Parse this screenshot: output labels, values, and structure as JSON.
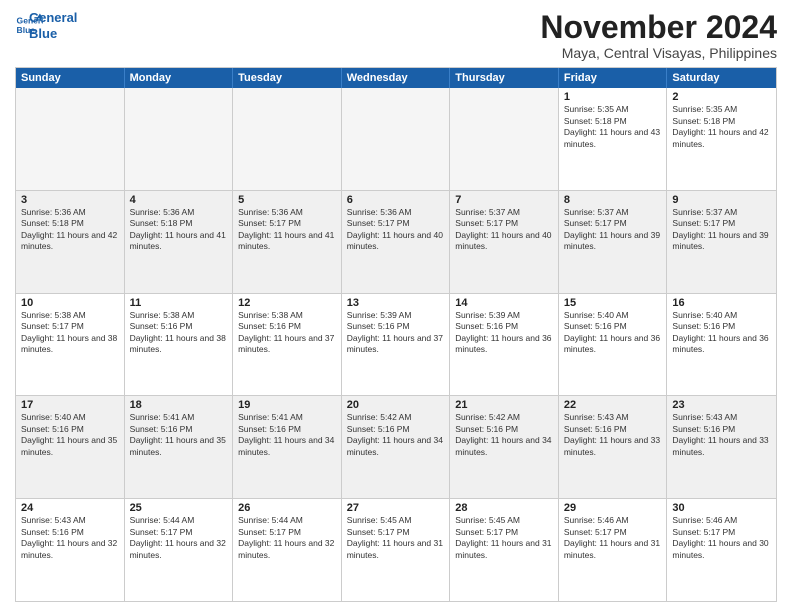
{
  "logo": {
    "line1": "General",
    "line2": "Blue"
  },
  "title": "November 2024",
  "location": "Maya, Central Visayas, Philippines",
  "days_of_week": [
    "Sunday",
    "Monday",
    "Tuesday",
    "Wednesday",
    "Thursday",
    "Friday",
    "Saturday"
  ],
  "weeks": [
    [
      {
        "day": "",
        "info": "",
        "empty": true
      },
      {
        "day": "",
        "info": "",
        "empty": true
      },
      {
        "day": "",
        "info": "",
        "empty": true
      },
      {
        "day": "",
        "info": "",
        "empty": true
      },
      {
        "day": "",
        "info": "",
        "empty": true
      },
      {
        "day": "1",
        "info": "Sunrise: 5:35 AM\nSunset: 5:18 PM\nDaylight: 11 hours and 43 minutes.",
        "empty": false
      },
      {
        "day": "2",
        "info": "Sunrise: 5:35 AM\nSunset: 5:18 PM\nDaylight: 11 hours and 42 minutes.",
        "empty": false
      }
    ],
    [
      {
        "day": "3",
        "info": "Sunrise: 5:36 AM\nSunset: 5:18 PM\nDaylight: 11 hours and 42 minutes.",
        "empty": false
      },
      {
        "day": "4",
        "info": "Sunrise: 5:36 AM\nSunset: 5:18 PM\nDaylight: 11 hours and 41 minutes.",
        "empty": false
      },
      {
        "day": "5",
        "info": "Sunrise: 5:36 AM\nSunset: 5:17 PM\nDaylight: 11 hours and 41 minutes.",
        "empty": false
      },
      {
        "day": "6",
        "info": "Sunrise: 5:36 AM\nSunset: 5:17 PM\nDaylight: 11 hours and 40 minutes.",
        "empty": false
      },
      {
        "day": "7",
        "info": "Sunrise: 5:37 AM\nSunset: 5:17 PM\nDaylight: 11 hours and 40 minutes.",
        "empty": false
      },
      {
        "day": "8",
        "info": "Sunrise: 5:37 AM\nSunset: 5:17 PM\nDaylight: 11 hours and 39 minutes.",
        "empty": false
      },
      {
        "day": "9",
        "info": "Sunrise: 5:37 AM\nSunset: 5:17 PM\nDaylight: 11 hours and 39 minutes.",
        "empty": false
      }
    ],
    [
      {
        "day": "10",
        "info": "Sunrise: 5:38 AM\nSunset: 5:17 PM\nDaylight: 11 hours and 38 minutes.",
        "empty": false
      },
      {
        "day": "11",
        "info": "Sunrise: 5:38 AM\nSunset: 5:16 PM\nDaylight: 11 hours and 38 minutes.",
        "empty": false
      },
      {
        "day": "12",
        "info": "Sunrise: 5:38 AM\nSunset: 5:16 PM\nDaylight: 11 hours and 37 minutes.",
        "empty": false
      },
      {
        "day": "13",
        "info": "Sunrise: 5:39 AM\nSunset: 5:16 PM\nDaylight: 11 hours and 37 minutes.",
        "empty": false
      },
      {
        "day": "14",
        "info": "Sunrise: 5:39 AM\nSunset: 5:16 PM\nDaylight: 11 hours and 36 minutes.",
        "empty": false
      },
      {
        "day": "15",
        "info": "Sunrise: 5:40 AM\nSunset: 5:16 PM\nDaylight: 11 hours and 36 minutes.",
        "empty": false
      },
      {
        "day": "16",
        "info": "Sunrise: 5:40 AM\nSunset: 5:16 PM\nDaylight: 11 hours and 36 minutes.",
        "empty": false
      }
    ],
    [
      {
        "day": "17",
        "info": "Sunrise: 5:40 AM\nSunset: 5:16 PM\nDaylight: 11 hours and 35 minutes.",
        "empty": false
      },
      {
        "day": "18",
        "info": "Sunrise: 5:41 AM\nSunset: 5:16 PM\nDaylight: 11 hours and 35 minutes.",
        "empty": false
      },
      {
        "day": "19",
        "info": "Sunrise: 5:41 AM\nSunset: 5:16 PM\nDaylight: 11 hours and 34 minutes.",
        "empty": false
      },
      {
        "day": "20",
        "info": "Sunrise: 5:42 AM\nSunset: 5:16 PM\nDaylight: 11 hours and 34 minutes.",
        "empty": false
      },
      {
        "day": "21",
        "info": "Sunrise: 5:42 AM\nSunset: 5:16 PM\nDaylight: 11 hours and 34 minutes.",
        "empty": false
      },
      {
        "day": "22",
        "info": "Sunrise: 5:43 AM\nSunset: 5:16 PM\nDaylight: 11 hours and 33 minutes.",
        "empty": false
      },
      {
        "day": "23",
        "info": "Sunrise: 5:43 AM\nSunset: 5:16 PM\nDaylight: 11 hours and 33 minutes.",
        "empty": false
      }
    ],
    [
      {
        "day": "24",
        "info": "Sunrise: 5:43 AM\nSunset: 5:16 PM\nDaylight: 11 hours and 32 minutes.",
        "empty": false
      },
      {
        "day": "25",
        "info": "Sunrise: 5:44 AM\nSunset: 5:17 PM\nDaylight: 11 hours and 32 minutes.",
        "empty": false
      },
      {
        "day": "26",
        "info": "Sunrise: 5:44 AM\nSunset: 5:17 PM\nDaylight: 11 hours and 32 minutes.",
        "empty": false
      },
      {
        "day": "27",
        "info": "Sunrise: 5:45 AM\nSunset: 5:17 PM\nDaylight: 11 hours and 31 minutes.",
        "empty": false
      },
      {
        "day": "28",
        "info": "Sunrise: 5:45 AM\nSunset: 5:17 PM\nDaylight: 11 hours and 31 minutes.",
        "empty": false
      },
      {
        "day": "29",
        "info": "Sunrise: 5:46 AM\nSunset: 5:17 PM\nDaylight: 11 hours and 31 minutes.",
        "empty": false
      },
      {
        "day": "30",
        "info": "Sunrise: 5:46 AM\nSunset: 5:17 PM\nDaylight: 11 hours and 30 minutes.",
        "empty": false
      }
    ]
  ]
}
